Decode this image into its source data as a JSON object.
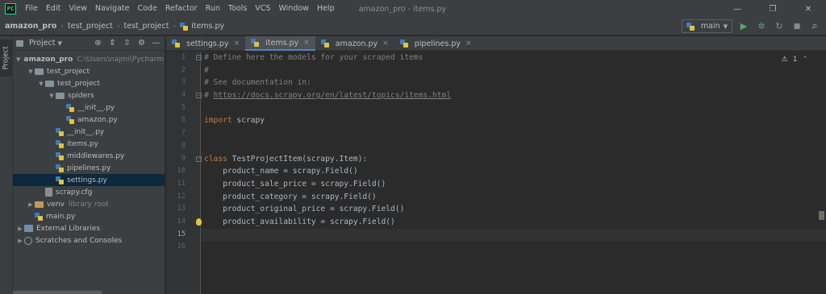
{
  "app": {
    "logo_text": "PC",
    "window_title": "amazon_pro - items.py"
  },
  "menu": [
    "File",
    "Edit",
    "View",
    "Navigate",
    "Code",
    "Refactor",
    "Run",
    "Tools",
    "VCS",
    "Window",
    "Help"
  ],
  "window_controls": {
    "minimize": "—",
    "restore": "❐",
    "close": "✕"
  },
  "breadcrumb": [
    "amazon_pro",
    "test_project",
    "test_project",
    "items.py"
  ],
  "toolbar": {
    "branch": "main",
    "run_icon": "▶",
    "debug_icon": "✲",
    "rerun_icon": "↻",
    "stop_icon": "■",
    "search_icon": "⌕"
  },
  "side_strip": {
    "project_tab": "Project"
  },
  "project_panel": {
    "title": "Project",
    "tree": [
      {
        "label": "amazon_pro",
        "hint": "C:\\Users\\najmi\\PycharmP",
        "depth": 0,
        "type": "project",
        "expanded": true,
        "bold": true
      },
      {
        "label": "test_project",
        "depth": 1,
        "type": "folder",
        "expanded": true
      },
      {
        "label": "test_project",
        "depth": 2,
        "type": "folder",
        "expanded": true
      },
      {
        "label": "spiders",
        "depth": 3,
        "type": "folder",
        "expanded": true
      },
      {
        "label": "__init__.py",
        "depth": 4,
        "type": "py"
      },
      {
        "label": "amazon.py",
        "depth": 4,
        "type": "py"
      },
      {
        "label": "__init__.py",
        "depth": 3,
        "type": "py"
      },
      {
        "label": "items.py",
        "depth": 3,
        "type": "py"
      },
      {
        "label": "middlewares.py",
        "depth": 3,
        "type": "py"
      },
      {
        "label": "pipelines.py",
        "depth": 3,
        "type": "py"
      },
      {
        "label": "settings.py",
        "depth": 3,
        "type": "py",
        "selected": true
      },
      {
        "label": "scrapy.cfg",
        "depth": 2,
        "type": "cfg"
      },
      {
        "label": "venv",
        "hint": "library root",
        "depth": 1,
        "type": "venv",
        "expanded": false
      },
      {
        "label": "main.py",
        "depth": 1,
        "type": "py"
      },
      {
        "label": "External Libraries",
        "depth": 0,
        "type": "lib",
        "expanded": false
      },
      {
        "label": "Scratches and Consoles",
        "depth": 0,
        "type": "scratch",
        "expanded": false
      }
    ]
  },
  "editor_tabs": [
    {
      "label": "settings.py",
      "active": false
    },
    {
      "label": "items.py",
      "active": true
    },
    {
      "label": "amazon.py",
      "active": false
    },
    {
      "label": "pipelines.py",
      "active": false
    }
  ],
  "inspections": {
    "warnings": "1"
  },
  "code_lines": [
    {
      "n": "1",
      "kind": "comment",
      "text": "# Define here the models for your scraped items"
    },
    {
      "n": "2",
      "kind": "comment",
      "text": "#"
    },
    {
      "n": "3",
      "kind": "comment",
      "text": "# See documentation in:"
    },
    {
      "n": "4",
      "kind": "link",
      "prefix": "# ",
      "text": "https://docs.scrapy.org/en/latest/topics/items.html"
    },
    {
      "n": "5",
      "kind": "blank",
      "text": ""
    },
    {
      "n": "6",
      "kind": "import",
      "keyword": "import",
      "text": " scrapy"
    },
    {
      "n": "7",
      "kind": "blank",
      "text": ""
    },
    {
      "n": "8",
      "kind": "blank",
      "text": ""
    },
    {
      "n": "9",
      "kind": "class",
      "keyword": "class",
      "text": " TestProjectItem(scrapy.Item):"
    },
    {
      "n": "10",
      "kind": "text",
      "text": "    product_name = scrapy.Field()"
    },
    {
      "n": "11",
      "kind": "text",
      "text": "    product_sale_price = scrapy.Field()"
    },
    {
      "n": "12",
      "kind": "text",
      "text": "    product_category = scrapy.Field()"
    },
    {
      "n": "13",
      "kind": "text",
      "text": "    product_original_price = scrapy.Field()"
    },
    {
      "n": "14",
      "kind": "text",
      "text": "    product_availability = scrapy.Field()"
    },
    {
      "n": "15",
      "kind": "blank",
      "text": "",
      "current": true
    },
    {
      "n": "16",
      "kind": "blank",
      "text": ""
    }
  ],
  "colors": {
    "keyword": "#cc7832",
    "comment": "#808080",
    "text": "#a9b7c6",
    "selection": "#0d293e",
    "tab_underline": "#4a88c7"
  }
}
